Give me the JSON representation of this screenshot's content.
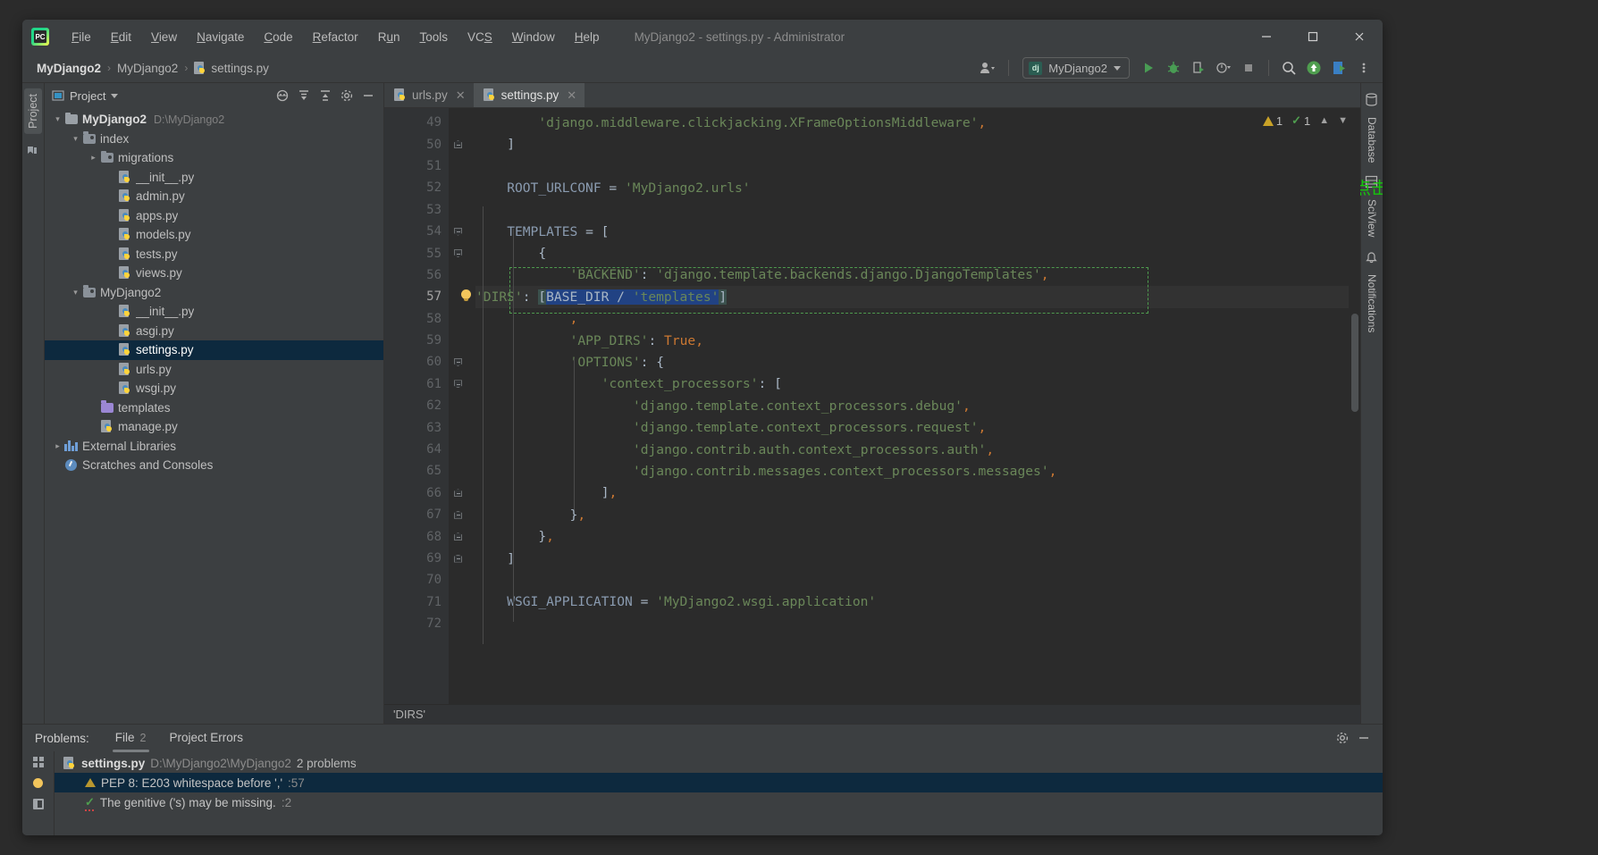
{
  "window": {
    "title": "MyDjango2 - settings.py - Administrator",
    "logo_text": "PC",
    "minimize": "—",
    "maximize": "☐",
    "close": "✕"
  },
  "menu": [
    {
      "label": "File"
    },
    {
      "label": "Edit"
    },
    {
      "label": "View"
    },
    {
      "label": "Navigate"
    },
    {
      "label": "Code"
    },
    {
      "label": "Refactor"
    },
    {
      "label": "Run"
    },
    {
      "label": "Tools"
    },
    {
      "label": "VCS"
    },
    {
      "label": "Window"
    },
    {
      "label": "Help"
    }
  ],
  "navbar": {
    "breadcrumbs": [
      {
        "label": "MyDjango2",
        "bold": true
      },
      {
        "label": "MyDjango2",
        "bold": false
      },
      {
        "label": "settings.py",
        "bold": false,
        "icon": "python-file-icon"
      }
    ],
    "separator": "›",
    "run_config": {
      "label": "MyDjango2",
      "icon": "django-icon",
      "badge": "dj"
    },
    "icons": [
      "user-dropdown-icon",
      "run-icon",
      "debug-icon",
      "coverage-icon",
      "profile-icon",
      "stop-icon",
      "search-icon",
      "update-icon",
      "plugin-icon"
    ],
    "more_icon": "more-options-icon"
  },
  "left_rail": {
    "project_label": "Project",
    "bookmark_icon": "bookmarks-icon"
  },
  "project_panel": {
    "title": "Project",
    "header_icons": [
      "locate-icon",
      "expand-all-icon",
      "collapse-all-icon",
      "settings-icon",
      "hide-icon"
    ],
    "tree": [
      {
        "label": "MyDjango2",
        "path": "D:\\MyDjango2",
        "depth": 0,
        "arrow": "down",
        "icon": "folder-icon",
        "bold": true,
        "selected": false
      },
      {
        "label": "index",
        "path": "",
        "depth": 1,
        "arrow": "down",
        "icon": "source-folder-icon",
        "bold": false,
        "selected": false
      },
      {
        "label": "migrations",
        "path": "",
        "depth": 2,
        "arrow": "right",
        "icon": "source-folder-icon",
        "bold": false,
        "selected": false
      },
      {
        "label": "__init__.py",
        "path": "",
        "depth": 3,
        "arrow": "none",
        "icon": "python-file-icon",
        "bold": false,
        "selected": false
      },
      {
        "label": "admin.py",
        "path": "",
        "depth": 3,
        "arrow": "none",
        "icon": "python-file-icon",
        "bold": false,
        "selected": false
      },
      {
        "label": "apps.py",
        "path": "",
        "depth": 3,
        "arrow": "none",
        "icon": "python-file-icon",
        "bold": false,
        "selected": false
      },
      {
        "label": "models.py",
        "path": "",
        "depth": 3,
        "arrow": "none",
        "icon": "python-file-icon",
        "bold": false,
        "selected": false
      },
      {
        "label": "tests.py",
        "path": "",
        "depth": 3,
        "arrow": "none",
        "icon": "python-file-icon",
        "bold": false,
        "selected": false
      },
      {
        "label": "views.py",
        "path": "",
        "depth": 3,
        "arrow": "none",
        "icon": "python-file-icon",
        "bold": false,
        "selected": false
      },
      {
        "label": "MyDjango2",
        "path": "",
        "depth": 1,
        "arrow": "down",
        "icon": "source-folder-icon",
        "bold": false,
        "selected": false
      },
      {
        "label": "__init__.py",
        "path": "",
        "depth": 3,
        "arrow": "none",
        "icon": "python-file-icon",
        "bold": false,
        "selected": false
      },
      {
        "label": "asgi.py",
        "path": "",
        "depth": 3,
        "arrow": "none",
        "icon": "python-file-icon",
        "bold": false,
        "selected": false
      },
      {
        "label": "settings.py",
        "path": "",
        "depth": 3,
        "arrow": "none",
        "icon": "python-file-icon",
        "bold": false,
        "selected": true
      },
      {
        "label": "urls.py",
        "path": "",
        "depth": 3,
        "arrow": "none",
        "icon": "python-file-icon",
        "bold": false,
        "selected": false
      },
      {
        "label": "wsgi.py",
        "path": "",
        "depth": 3,
        "arrow": "none",
        "icon": "python-file-icon",
        "bold": false,
        "selected": false
      },
      {
        "label": "templates",
        "path": "",
        "depth": 2,
        "arrow": "none",
        "icon": "templates-folder-icon",
        "bold": false,
        "selected": false
      },
      {
        "label": "manage.py",
        "path": "",
        "depth": 2,
        "arrow": "none",
        "icon": "python-file-icon",
        "bold": false,
        "selected": false
      },
      {
        "label": "External Libraries",
        "path": "",
        "depth": 0,
        "arrow": "right",
        "icon": "library-icon",
        "bold": false,
        "selected": false
      },
      {
        "label": "Scratches and Consoles",
        "path": "",
        "depth": 0,
        "arrow": "none",
        "icon": "scratches-icon",
        "bold": false,
        "selected": false
      }
    ]
  },
  "editor": {
    "tabs": [
      {
        "label": "urls.py",
        "active": false,
        "icon": "python-file-icon",
        "close": "✕"
      },
      {
        "label": "settings.py",
        "active": true,
        "icon": "python-file-icon",
        "close": "✕"
      }
    ],
    "first_line_number": 49,
    "current_line": 57,
    "lines": [
      {
        "n": 49,
        "text": "        'django.middleware.clickjacking.XFrameOptionsMiddleware',"
      },
      {
        "n": 50,
        "text": "    ]"
      },
      {
        "n": 51,
        "text": ""
      },
      {
        "n": 52,
        "text": "    ROOT_URLCONF = 'MyDjango2.urls'"
      },
      {
        "n": 53,
        "text": ""
      },
      {
        "n": 54,
        "text": "    TEMPLATES = ["
      },
      {
        "n": 55,
        "text": "        {"
      },
      {
        "n": 56,
        "text": "            'BACKEND': 'django.template.backends.django.DjangoTemplates',"
      },
      {
        "n": 57,
        "text": "            'DIRS': [BASE_DIR / 'templates']"
      },
      {
        "n": 58,
        "text": "            ,"
      },
      {
        "n": 59,
        "text": "            'APP_DIRS': True,"
      },
      {
        "n": 60,
        "text": "            'OPTIONS': {"
      },
      {
        "n": 61,
        "text": "                'context_processors': ["
      },
      {
        "n": 62,
        "text": "                    'django.template.context_processors.debug',"
      },
      {
        "n": 63,
        "text": "                    'django.template.context_processors.request',"
      },
      {
        "n": 64,
        "text": "                    'django.contrib.auth.context_processors.auth',"
      },
      {
        "n": 65,
        "text": "                    'django.contrib.messages.context_processors.messages',"
      },
      {
        "n": 66,
        "text": "                ],"
      },
      {
        "n": 67,
        "text": "            },"
      },
      {
        "n": 68,
        "text": "        },"
      },
      {
        "n": 69,
        "text": "    ]"
      },
      {
        "n": 70,
        "text": ""
      },
      {
        "n": 71,
        "text": "    WSGI_APPLICATION = 'MyDjango2.wsgi.application'"
      },
      {
        "n": 72,
        "text": ""
      }
    ],
    "inspection": {
      "warnings": "1",
      "checks": "1",
      "up_arrow": "⌃",
      "down_arrow": "⌄"
    },
    "status_breadcrumb": "'DIRS'",
    "annotation": "点击规范提升快速定位",
    "annotation_color": "#16c60c"
  },
  "right_rail": {
    "items": [
      {
        "label": "Database",
        "icon": "database-icon"
      },
      {
        "label": "SciView",
        "icon": "sciview-icon"
      },
      {
        "label": "Notifications",
        "icon": "notifications-icon"
      }
    ]
  },
  "problems": {
    "label": "Problems:",
    "tabs": [
      {
        "label": "File",
        "count": "2",
        "active": true
      },
      {
        "label": "Project Errors",
        "count": "",
        "active": false
      }
    ],
    "header_icons": [
      "settings-icon",
      "hide-icon"
    ],
    "rail_icons": [
      "group-icon",
      "bulb-icon",
      "preview-icon"
    ],
    "rows": [
      {
        "type": "file",
        "icon": "python-file-icon",
        "name": "settings.py",
        "path": "D:\\MyDjango2\\MyDjango2",
        "count": "2 problems",
        "selected": false
      },
      {
        "type": "warning",
        "icon": "warning-icon",
        "message": "PEP 8: E203 whitespace before ','",
        "line": ":57",
        "selected": true
      },
      {
        "type": "grammar",
        "icon": "grammar-check-icon",
        "message": "The genitive ('s) may be missing.",
        "line": ":2",
        "selected": false
      }
    ]
  }
}
